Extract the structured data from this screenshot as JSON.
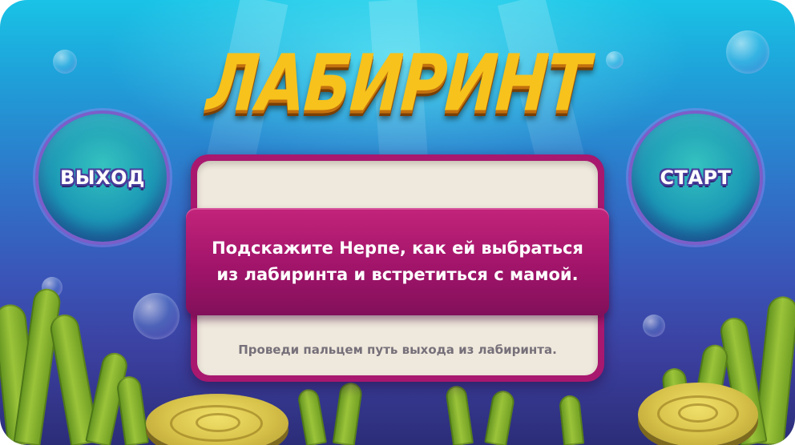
{
  "game": {
    "title": "ЛАБИРИНТ",
    "buttons": {
      "exit_label": "ВЫХОД",
      "start_label": "СТАРТ"
    },
    "dialog": {
      "message_line1": "Подскажите Нерпе, как ей выбраться",
      "message_line2": "из лабиринта и встретиться с мамой.",
      "hint": "Проведи пальцем путь выхода из лабиринта."
    },
    "icons": [
      "bubble-icon",
      "seaweed-icon",
      "rock-icon"
    ],
    "colors": {
      "title": "#f7c21c",
      "ribbon": "#a8186e",
      "panel": "#efe8dc",
      "button": "#1c98b6",
      "button_border": "#7c5ec9"
    }
  }
}
